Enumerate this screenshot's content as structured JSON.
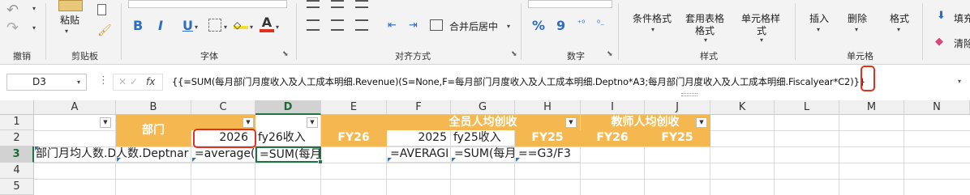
{
  "ribbon": {
    "groups": {
      "undo": "撤销",
      "clipboard": "剪贴板",
      "font": "字体",
      "alignment": "对齐方式",
      "number": "数字",
      "styles": "样式",
      "cells": "单元格"
    },
    "paste_label": "粘贴",
    "merge_label": "合并后居中",
    "cond_format_label": "条件格式",
    "table_format_label_1": "套用表格",
    "table_format_label_2": "格式",
    "cell_style_label_1": "单元格样",
    "cell_style_label_2": "式",
    "insert_label": "插入",
    "delete_label": "删除",
    "format_label": "格式",
    "fill_label": "填充",
    "clear_label": "清除",
    "bold": "B",
    "italic": "I",
    "underline": "U",
    "font_color_letter": "A",
    "percent": "%",
    "comma": "9"
  },
  "formula_bar": {
    "name_box": "D3",
    "fx": "fx",
    "formula_before": "{{=SUM(每月部门月度收入及人工成本明细.Revenue)(S=None,F=每月部门月度收入及人工成本明细.Deptno*A3;每月部门月度收入及人工成本明细.Fiscalyear*",
    "formula_highlight": "C2",
    "formula_after": ")}}"
  },
  "grid": {
    "columns": [
      "A",
      "B",
      "C",
      "D",
      "E",
      "F",
      "G",
      "H",
      "I",
      "J",
      "K",
      "L",
      "M",
      "N"
    ],
    "rows": [
      "1",
      "2",
      "3",
      "4",
      "5"
    ],
    "active_col": "D",
    "active_row": "3",
    "cells": {
      "B1": "部门",
      "C2": "2026",
      "D2": "fy26收入",
      "E2": "FY26",
      "F1": "全员人均创收",
      "F2": "2025",
      "G2": "fy25收入",
      "H2": "FY25",
      "I1": "教师人均创收",
      "I2": "FY26",
      "J2": "FY25",
      "A3": "部门月均人数.D",
      "B3": "人数.Deptnar",
      "C3": "=average(",
      "D3": "=SUM(每月",
      "F3": "=AVERAGI",
      "G3": "=SUM(每月",
      "H3": "==G3/F3"
    }
  },
  "colors": {
    "header_fill": "#f5b851",
    "highlight_border": "#e0301e",
    "selection": "#217346"
  }
}
